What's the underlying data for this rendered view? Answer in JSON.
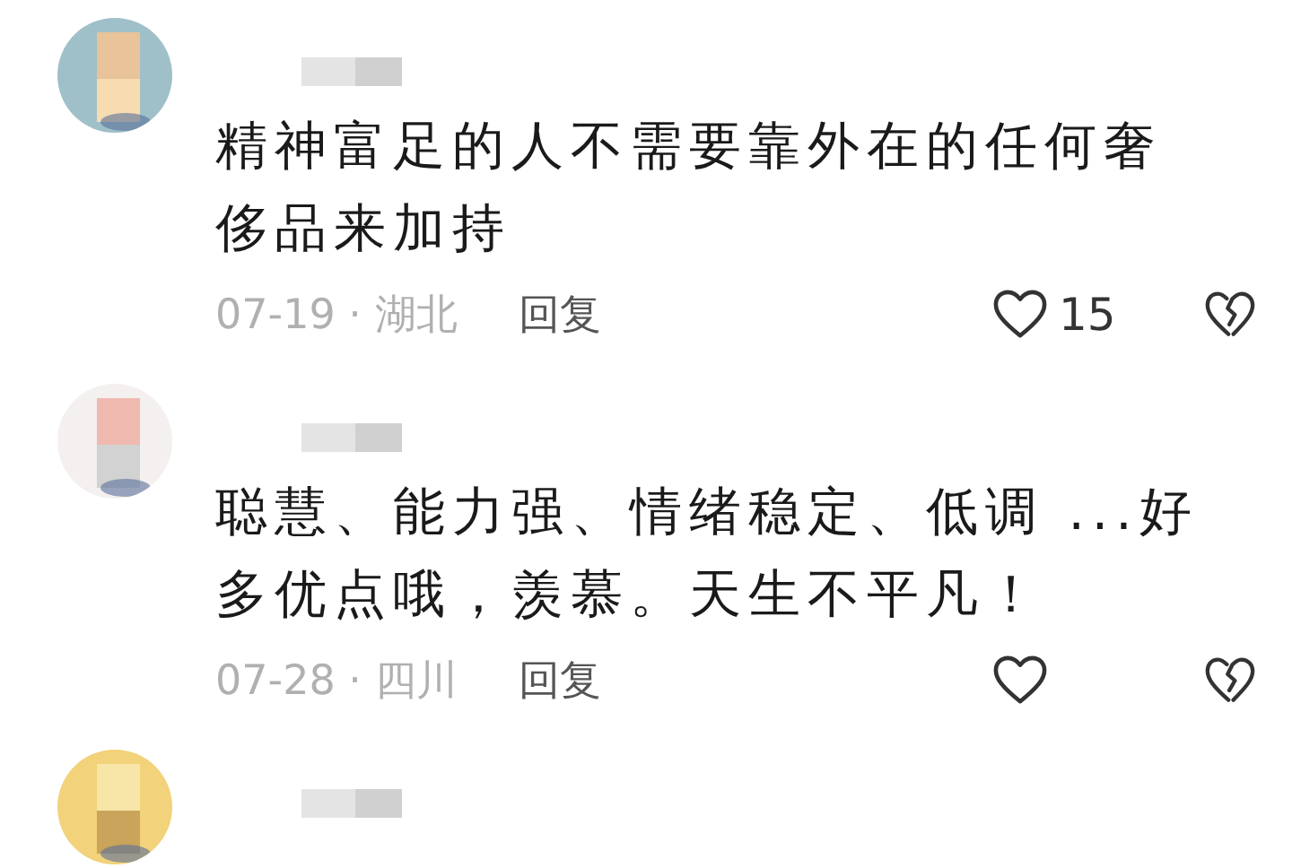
{
  "comments": [
    {
      "avatar": {
        "kind": "picture"
      },
      "text": "精神富足的人不需要靠外在的任何奢侈品来加持",
      "date": "07-19 · 湖北",
      "reply": "回复",
      "likes": "15",
      "liked": false
    },
    {
      "avatar": {
        "kind": "picture"
      },
      "text": "聪慧、能力强、情绪稳定、低调 ...好多优点哦，羡慕。天生不平凡！",
      "date": "07-28 · 四川",
      "reply": "回复",
      "liked": false
    },
    {
      "avatar": {
        "kind": "picture"
      }
    }
  ]
}
